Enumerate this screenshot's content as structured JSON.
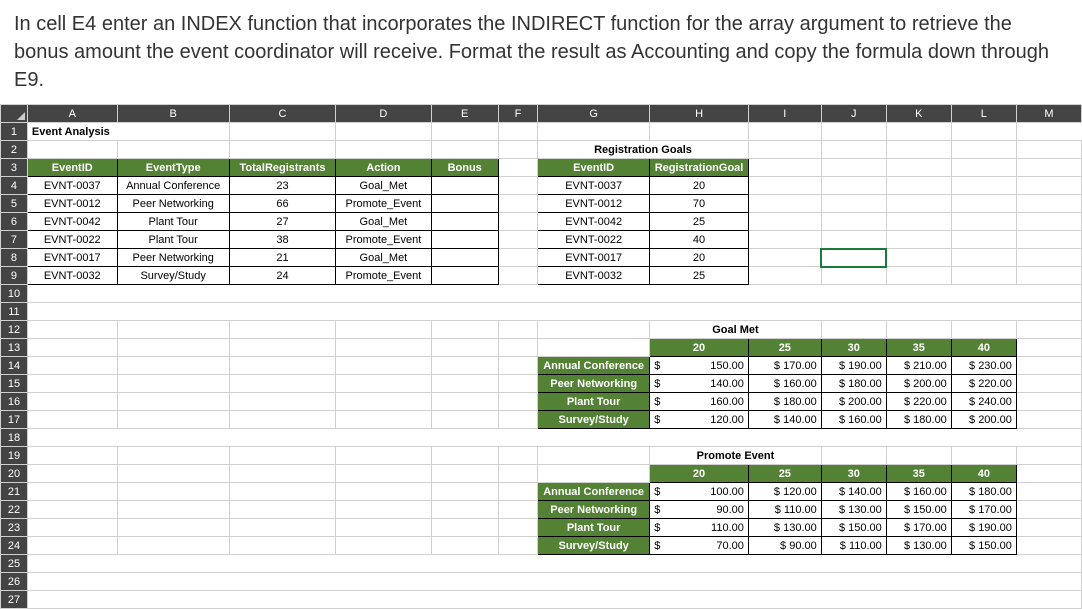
{
  "instruction": "In cell E4 enter an INDEX function that incorporates the INDIRECT function for the array argument to retrieve the bonus amount the event coordinator will receive. Format the result as Accounting and copy the formula down through E9.",
  "cols": [
    "A",
    "B",
    "C",
    "D",
    "E",
    "F",
    "G",
    "H",
    "I",
    "J",
    "K",
    "L",
    "M"
  ],
  "a1": "Event Analysis",
  "main_hdr": {
    "a": "EventID",
    "b": "EventType",
    "c": "TotalRegistrants",
    "d": "Action",
    "e": "Bonus"
  },
  "main_rows": [
    {
      "a": "EVNT-0037",
      "b": "Annual Conference",
      "c": "23",
      "d": "Goal_Met"
    },
    {
      "a": "EVNT-0012",
      "b": "Peer Networking",
      "c": "66",
      "d": "Promote_Event"
    },
    {
      "a": "EVNT-0042",
      "b": "Plant Tour",
      "c": "27",
      "d": "Goal_Met"
    },
    {
      "a": "EVNT-0022",
      "b": "Plant Tour",
      "c": "38",
      "d": "Promote_Event"
    },
    {
      "a": "EVNT-0017",
      "b": "Peer Networking",
      "c": "21",
      "d": "Goal_Met"
    },
    {
      "a": "EVNT-0032",
      "b": "Survey/Study",
      "c": "24",
      "d": "Promote_Event"
    }
  ],
  "reg_title": "Registration Goals",
  "reg_hdr": {
    "g": "EventID",
    "h": "RegistrationGoal"
  },
  "reg_rows": [
    {
      "g": "EVNT-0037",
      "h": "20"
    },
    {
      "g": "EVNT-0012",
      "h": "70"
    },
    {
      "g": "EVNT-0042",
      "h": "25"
    },
    {
      "g": "EVNT-0022",
      "h": "40"
    },
    {
      "g": "EVNT-0017",
      "h": "20"
    },
    {
      "g": "EVNT-0032",
      "h": "25"
    }
  ],
  "goal_met_title": "Goal Met",
  "promote_title": "Promote Event",
  "tiers": [
    "20",
    "25",
    "30",
    "35",
    "40"
  ],
  "categories": [
    "Annual Conference",
    "Peer Networking",
    "Plant Tour",
    "Survey/Study"
  ],
  "goal_met_rows": [
    [
      "150.00",
      "$ 170.00",
      "$ 190.00",
      "$ 210.00",
      "$ 230.00"
    ],
    [
      "140.00",
      "$ 160.00",
      "$ 180.00",
      "$ 200.00",
      "$ 220.00"
    ],
    [
      "160.00",
      "$ 180.00",
      "$ 200.00",
      "$ 220.00",
      "$ 240.00"
    ],
    [
      "120.00",
      "$ 140.00",
      "$ 160.00",
      "$ 180.00",
      "$ 200.00"
    ]
  ],
  "promote_rows": [
    [
      "100.00",
      "$ 120.00",
      "$ 140.00",
      "$ 160.00",
      "$ 180.00"
    ],
    [
      "90.00",
      "$ 110.00",
      "$ 130.00",
      "$ 150.00",
      "$ 170.00"
    ],
    [
      "110.00",
      "$ 130.00",
      "$ 150.00",
      "$ 170.00",
      "$ 190.00"
    ],
    [
      "70.00",
      "$  90.00",
      "$ 110.00",
      "$ 130.00",
      "$ 150.00"
    ]
  ],
  "currency_symbol": "$"
}
